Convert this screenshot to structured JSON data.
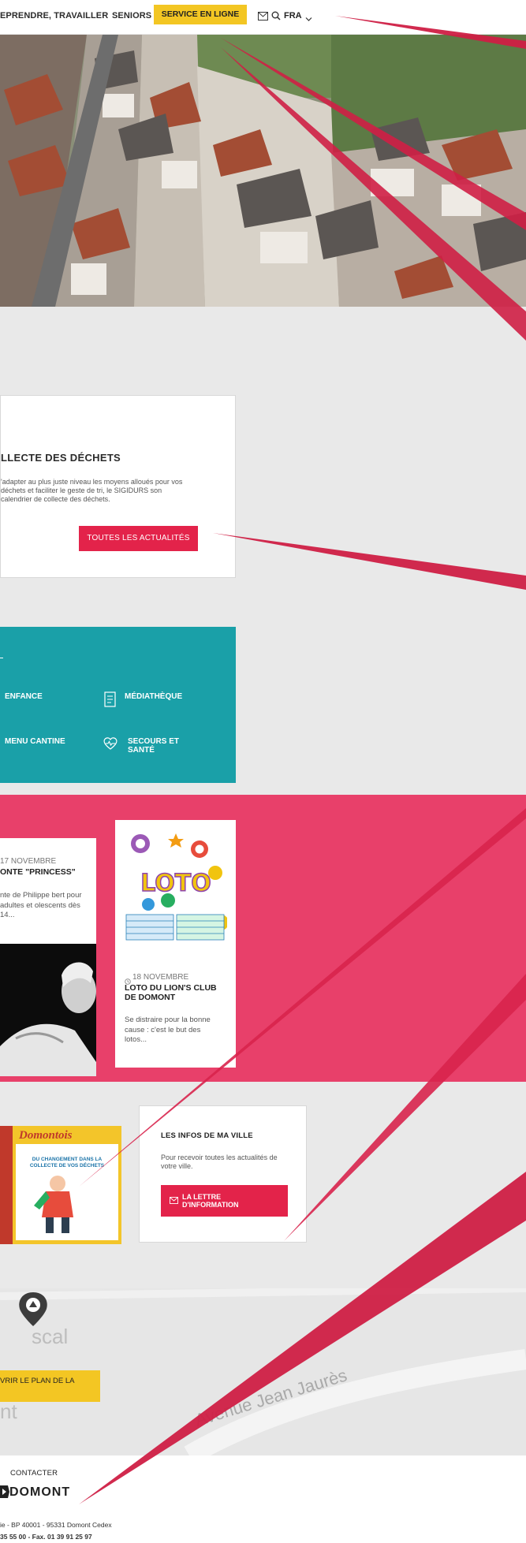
{
  "header": {
    "nav": [
      "EPRENDRE, TRAVAILLER",
      "SENIORS"
    ],
    "service_label": "SERVICE EN LIGNE",
    "language": "FRA"
  },
  "news": {
    "title": "LLECTE DES DÉCHETS",
    "text": "'adapter au plus juste niveau les moyens alloués pour vos déchets et faciliter le geste de tri, le SIGIDURS son calendrier de collecte des déchets.",
    "button_label": "TOUTES LES ACTUALITÉS"
  },
  "quick_links": [
    {
      "label": "ENFANCE",
      "icon": "child-icon"
    },
    {
      "label": "MÉDIATHÈQUE",
      "icon": "book-icon"
    },
    {
      "label": "MENU CANTINE",
      "icon": "menu-icon"
    },
    {
      "label": "SECOURS ET SANTÉ",
      "icon": "heart-pulse-icon"
    }
  ],
  "events": [
    {
      "date": "17 NOVEMBRE",
      "title": "ONTE \"PRINCESS\"",
      "text": "nte de Philippe bert pour adultes et olescents dès 14..."
    },
    {
      "date": "18 NOVEMBRE",
      "title": "LOTO DU LION'S CLUB DE DOMONT",
      "text": "Se distraire pour la bonne cause : c'est le but des lotos...",
      "image_text": "LOTO"
    }
  ],
  "magazine": {
    "name": "Domontois",
    "headline": "DU CHANGEMENT DANS LA COLLECTE DE VOS DÉCHETS"
  },
  "infos": {
    "title": "LES INFOS DE MA VILLE",
    "text": "Pour recevoir toutes les actualités de votre ville.",
    "button_label": "LA LETTRE D'INFORMATION"
  },
  "map": {
    "street_label": "Avenue Jean Jaurès",
    "button_label": "VRIR LE PLAN DE LA"
  },
  "footer": {
    "contact_label": "CONTACTER",
    "logo": "DOMONT",
    "address": "ie - BP 40001 - 95331 Domont Cedex",
    "phone": "35 55 00 - Fax. 01 39 91 25 97"
  },
  "colors": {
    "accent_red": "#e3234a",
    "accent_yellow": "#f3c623",
    "teal": "#1aa0a8",
    "pink": "#e8406a"
  }
}
